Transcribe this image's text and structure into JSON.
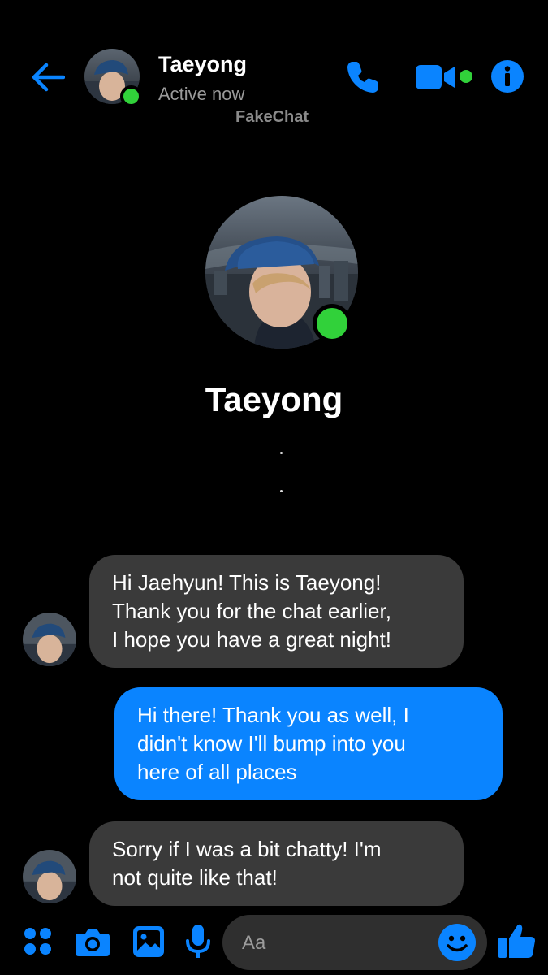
{
  "header": {
    "contact_name": "Taeyong",
    "status": "Active now",
    "watermark": "FakeChat",
    "back_icon": "arrow-left-icon",
    "call_icon": "phone-icon",
    "video_icon": "video-camera-icon",
    "info_icon": "info-icon"
  },
  "profile": {
    "name": "Taeyong"
  },
  "messages": [
    {
      "direction": "incoming",
      "lines": [
        "Hi Jaehyun! This is Taeyong!",
        "Thank you for the chat earlier,",
        "I hope you have a great night!"
      ]
    },
    {
      "direction": "outgoing",
      "lines": [
        "Hi there! Thank you as well, I",
        "didn't know I'll bump into you",
        "here of all places"
      ]
    },
    {
      "direction": "incoming",
      "lines": [
        "Sorry if I was a bit chatty! I'm",
        "not quite like that!"
      ]
    }
  ],
  "composer": {
    "placeholder": "Aa",
    "icons": [
      "apps-icon",
      "camera-icon",
      "image-icon",
      "microphone-icon",
      "emoji-icon",
      "thumbs-up-icon"
    ]
  },
  "colors": {
    "accent": "#0a84ff",
    "online": "#31d13a",
    "incoming_bubble": "#3a3a3a",
    "background": "#000000"
  }
}
